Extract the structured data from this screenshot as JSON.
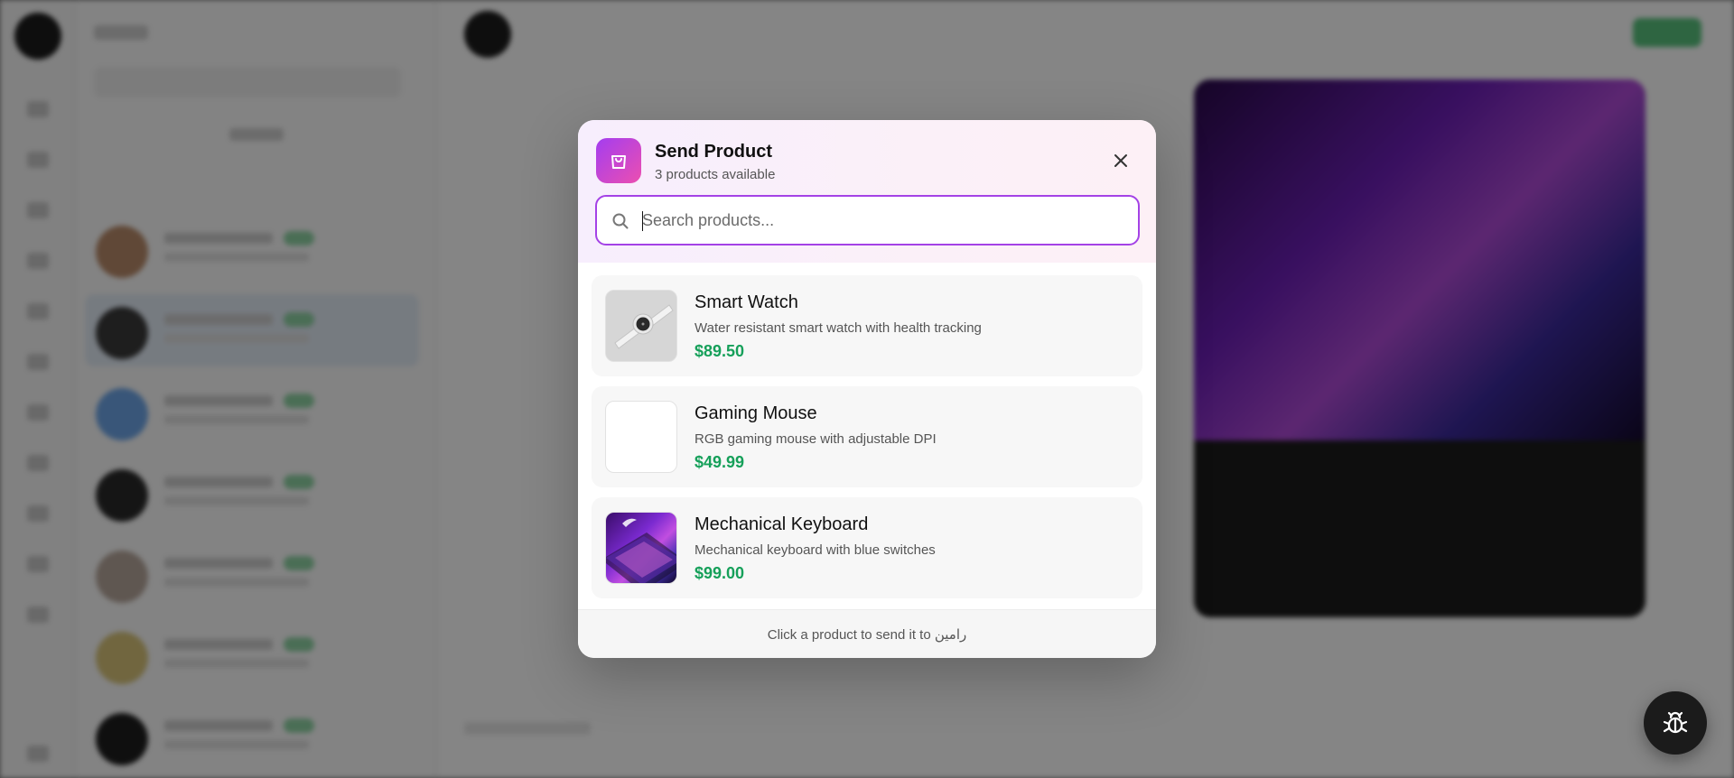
{
  "modal": {
    "title": "Send Product",
    "subtitle": "3 products available",
    "search_placeholder": "Search products...",
    "footer_text": "Click a product to send it to رامین",
    "accent_color": "#a442e6",
    "icon": "shopping-bag-icon",
    "close_icon": "close-icon"
  },
  "products": [
    {
      "name": "Smart Watch",
      "description": "Water resistant smart watch with health tracking",
      "price": "$89.50",
      "thumbnail": "smart-watch-image"
    },
    {
      "name": "Gaming Mouse",
      "description": "RGB gaming mouse with adjustable DPI",
      "price": "$49.99",
      "thumbnail": "blank-image"
    },
    {
      "name": "Mechanical Keyboard",
      "description": "Mechanical keyboard with blue switches",
      "price": "$99.00",
      "thumbnail": "keyboard-image"
    }
  ],
  "price_color": "#16a05a",
  "floating_button": {
    "icon": "bug-icon"
  }
}
